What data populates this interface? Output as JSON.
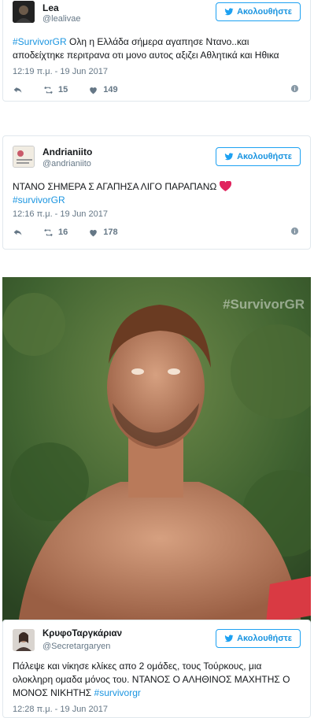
{
  "tweets": [
    {
      "name": "Lea",
      "handle": "@lealivae",
      "follow_label": "Ακολουθήστε",
      "hashtag": "#SurvivorGR",
      "text": " Ολη η Ελλάδα σήμερα αγαπησε Ντανο..και αποδείχτηκε περιτρανα οτι μονο αυτος αξιζει Αθλητικά και Ηθικα",
      "time": "12:19 π.μ. - 19 Jun 2017",
      "retweets": "15",
      "likes": "149"
    },
    {
      "name": "Andrianiito",
      "handle": "@andrianiito",
      "follow_label": "Ακολουθήστε",
      "text": "ΝΤΑΝΟ ΣΗΜΕΡΑ Σ ΑΓΑΠΗΣΑ ΛΙΓΟ ΠΑΡΑΠΑΝΩ",
      "hashtag": "#survivorGR",
      "time": "12:16 π.μ. - 19 Jun 2017",
      "retweets": "16",
      "likes": "178"
    },
    {
      "name": "ΚρυφοΤαργκάριαν",
      "handle": "@Secretargaryen",
      "follow_label": "Ακολουθήστε",
      "text": "Πάλεψε και νίκησε κλίκες απο 2 ομάδες, τους Τούρκους, μια ολοκληρη ομαδα μόνος του. ΝΤΑΝΟΣ Ο ΑΛΗΘΙΝΟΣ ΜΑΧΗΤΗΣ Ο ΜΟΝΟΣ ΝΙΚΗΤΗΣ",
      "hashtag": "#survivorgr",
      "time": "12:28 π.μ. - 19 Jun 2017"
    }
  ],
  "photo": {
    "watermark": "#SurvivorGR"
  },
  "colors": {
    "link": "#1b95e0",
    "muted": "#657786",
    "heart": "#e0245e"
  }
}
